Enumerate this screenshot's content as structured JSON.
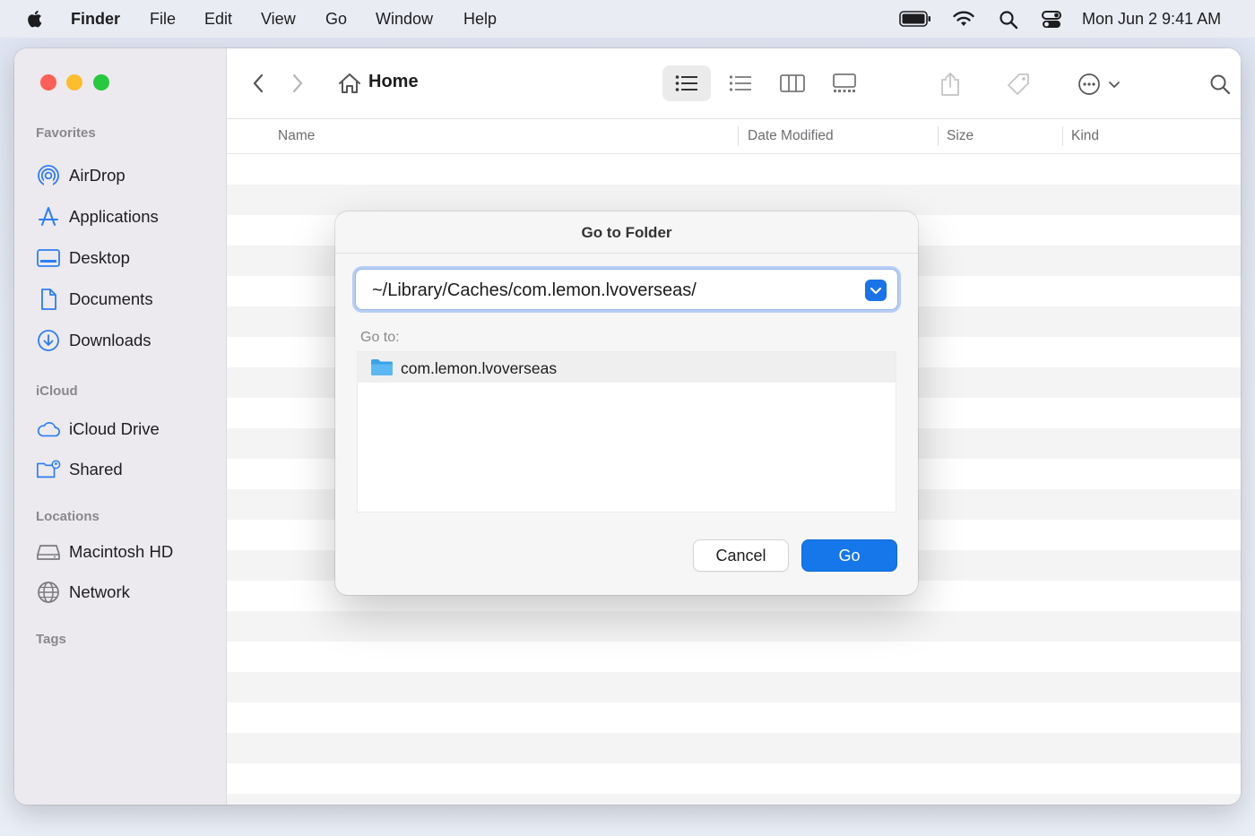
{
  "menubar": {
    "app_name": "Finder",
    "menus": [
      "File",
      "Edit",
      "View",
      "Go",
      "Window",
      "Help"
    ],
    "datetime": "Mon Jun 2  9:41 AM",
    "icons": [
      "battery-icon",
      "wifi-icon",
      "spotlight-search-icon",
      "control-center-icon"
    ]
  },
  "sidebar": {
    "sections": {
      "favorites": "Favorites",
      "icloud": "iCloud",
      "locations": "Locations",
      "tags": "Tags"
    },
    "favorites": [
      "AirDrop",
      "Applications",
      "Desktop",
      "Documents",
      "Downloads"
    ],
    "icloud": [
      "iCloud Drive",
      "Shared"
    ],
    "locations": [
      "Macintosh HD",
      "Network"
    ]
  },
  "toolbar": {
    "title": "Home",
    "active_view": "list"
  },
  "columns": [
    "Name",
    "Date Modified",
    "Size",
    "Kind"
  ],
  "dialog": {
    "title": "Go to Folder",
    "path_value": "~/Library/Caches/com.lemon.lvoverseas/",
    "goto_label": "Go to:",
    "results": [
      "com.lemon.lvoverseas"
    ],
    "cancel_label": "Cancel",
    "go_label": "Go"
  },
  "colors": {
    "accent": "#1577ea",
    "traffic_red": "#fe5f57",
    "traffic_yellow": "#febc2e",
    "traffic_green": "#28c840",
    "sidebar_icon": "#2e7cf6"
  }
}
